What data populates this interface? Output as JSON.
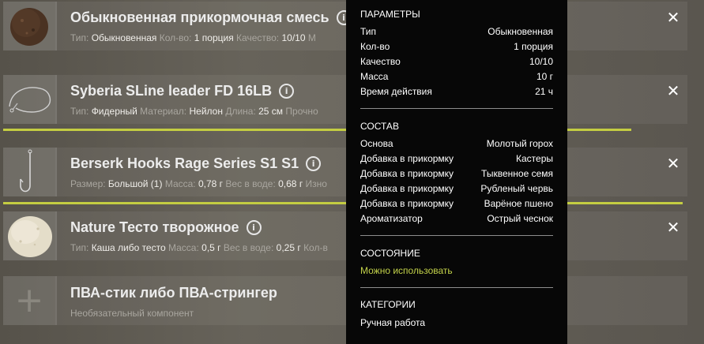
{
  "items": [
    {
      "title": "Обыкновенная прикормочная смесь",
      "props": [
        {
          "k": "Тип:",
          "v": "Обыкновенная"
        },
        {
          "k": "Кол-во:",
          "v": "1 порция"
        },
        {
          "k": "Качество:",
          "v": "10/10"
        },
        {
          "k": "М",
          "v": ""
        }
      ]
    },
    {
      "title": "Syberia SLine leader FD 16LB",
      "props": [
        {
          "k": "Тип:",
          "v": "Фидерный"
        },
        {
          "k": "Материал:",
          "v": "Нейлон"
        },
        {
          "k": "Длина:",
          "v": "25 см"
        },
        {
          "k": "Прочно",
          "v": ""
        }
      ],
      "durability": 0.96
    },
    {
      "title": "Berserk Hooks Rage Series S1 S1",
      "props": [
        {
          "k": "Размер:",
          "v": "Большой (1)"
        },
        {
          "k": "Масса:",
          "v": "0,78 г"
        },
        {
          "k": "Вес в воде:",
          "v": "0,68 г"
        },
        {
          "k": "Изно",
          "v": ""
        }
      ],
      "durability": 1.0
    },
    {
      "title": "Nature Тесто творожное",
      "props": [
        {
          "k": "Тип:",
          "v": "Каша либо тесто"
        },
        {
          "k": "Масса:",
          "v": "0,5 г"
        },
        {
          "k": "Вес в воде:",
          "v": "0,25 г"
        },
        {
          "k": "Кол-в",
          "v": ""
        }
      ]
    },
    {
      "title": "ПВА-стик либо ПВА-стрингер",
      "subtitle": "Необязательный компонент"
    }
  ],
  "close_glyph": "✕",
  "info_glyph": "i",
  "plus_glyph": "+",
  "tooltip": {
    "params_title": "ПАРАМЕТРЫ",
    "params": [
      {
        "k": "Тип",
        "v": "Обыкновенная"
      },
      {
        "k": "Кол-во",
        "v": "1 порция"
      },
      {
        "k": "Качество",
        "v": "10/10"
      },
      {
        "k": "Масса",
        "v": "10 г"
      },
      {
        "k": "Время действия",
        "v": "21 ч"
      }
    ],
    "composition_title": "СОСТАВ",
    "composition": [
      {
        "k": "Основа",
        "v": "Молотый горох"
      },
      {
        "k": "Добавка в прикормку",
        "v": "Кастеры"
      },
      {
        "k": "Добавка в прикормку",
        "v": "Тыквенное семя"
      },
      {
        "k": "Добавка в прикормку",
        "v": "Рубленый червь"
      },
      {
        "k": "Добавка в прикормку",
        "v": "Варёное пшено"
      },
      {
        "k": "Ароматизатор",
        "v": "Острый чеснок"
      }
    ],
    "state_title": "СОСТОЯНИЕ",
    "state_value": "Можно использовать",
    "categories_title": "КАТЕГОРИИ",
    "categories_value": "Ручная работа"
  },
  "colors": {
    "accent_bar": "#c4cd42",
    "state_ok": "#c3d24a",
    "tooltip_bg": "#070707"
  }
}
